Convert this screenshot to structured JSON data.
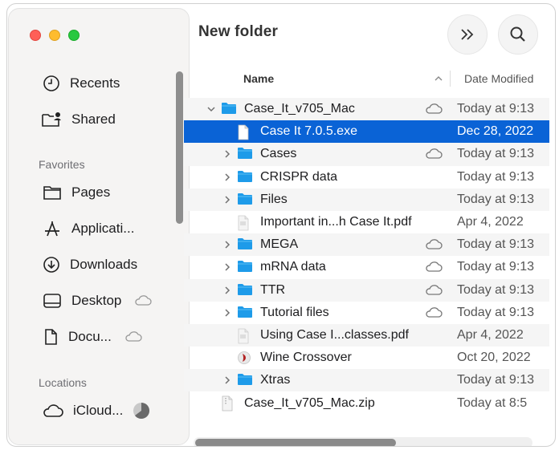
{
  "window": {
    "title": "New folder"
  },
  "toolbar": {
    "more_icon": "double-chevron-right-icon",
    "search_icon": "search-icon"
  },
  "sidebar": {
    "items_top": [
      {
        "label": "Recents",
        "icon": "clock-icon"
      },
      {
        "label": "Shared",
        "icon": "shared-folder-icon"
      }
    ],
    "favorites_header": "Favorites",
    "favorites": [
      {
        "label": "Pages",
        "icon": "folder-icon"
      },
      {
        "label": "Applicati...",
        "icon": "applications-icon"
      },
      {
        "label": "Downloads",
        "icon": "download-icon"
      },
      {
        "label": "Desktop",
        "icon": "desktop-icon",
        "cloud": true
      },
      {
        "label": "Docu...",
        "icon": "document-icon",
        "cloud": true
      }
    ],
    "locations_header": "Locations",
    "locations": [
      {
        "label": "iCloud...",
        "icon": "cloud-icon",
        "progress": 0.65
      }
    ]
  },
  "columns": {
    "name": "Name",
    "date": "Date Modified",
    "sort_icon": "chevron-up-icon"
  },
  "files": [
    {
      "name": "Case_It_v705_Mac",
      "type": "folder",
      "level": 0,
      "disclosure": "open",
      "cloud": true,
      "date": "Today at 9:13"
    },
    {
      "name": "Case It 7.0.5.exe",
      "type": "file",
      "level": 1,
      "disclosure": "none",
      "cloud": false,
      "date": "Dec 28, 2022",
      "selected": true
    },
    {
      "name": "Cases",
      "type": "folder",
      "level": 1,
      "disclosure": "closed",
      "cloud": true,
      "date": "Today at 9:13"
    },
    {
      "name": "CRISPR data",
      "type": "folder",
      "level": 1,
      "disclosure": "closed",
      "cloud": false,
      "date": "Today at 9:13"
    },
    {
      "name": "Files",
      "type": "folder",
      "level": 1,
      "disclosure": "closed",
      "cloud": false,
      "date": "Today at 9:13"
    },
    {
      "name": "Important in...h Case It.pdf",
      "type": "pdf",
      "level": 1,
      "disclosure": "none",
      "cloud": false,
      "date": "Apr 4, 2022"
    },
    {
      "name": "MEGA",
      "type": "folder",
      "level": 1,
      "disclosure": "closed",
      "cloud": true,
      "date": "Today at 9:13"
    },
    {
      "name": "mRNA data",
      "type": "folder",
      "level": 1,
      "disclosure": "closed",
      "cloud": true,
      "date": "Today at 9:13"
    },
    {
      "name": "TTR",
      "type": "folder",
      "level": 1,
      "disclosure": "closed",
      "cloud": true,
      "date": "Today at 9:13"
    },
    {
      "name": "Tutorial files",
      "type": "folder",
      "level": 1,
      "disclosure": "closed",
      "cloud": true,
      "date": "Today at 9:13"
    },
    {
      "name": "Using Case I...classes.pdf",
      "type": "pdf",
      "level": 1,
      "disclosure": "none",
      "cloud": false,
      "date": "Apr 4, 2022"
    },
    {
      "name": "Wine Crossover",
      "type": "app",
      "level": 1,
      "disclosure": "none",
      "cloud": false,
      "date": "Oct 20, 2022"
    },
    {
      "name": "Xtras",
      "type": "folder",
      "level": 1,
      "disclosure": "closed",
      "cloud": false,
      "date": "Today at 9:13"
    },
    {
      "name": "Case_It_v705_Mac.zip",
      "type": "zip",
      "level": 0,
      "disclosure": "none",
      "cloud": false,
      "date": "Today at 8:5"
    }
  ],
  "colors": {
    "selection": "#0a63d6",
    "folder": "#1e9be9",
    "sidebar_bg": "#f5f4f3"
  }
}
